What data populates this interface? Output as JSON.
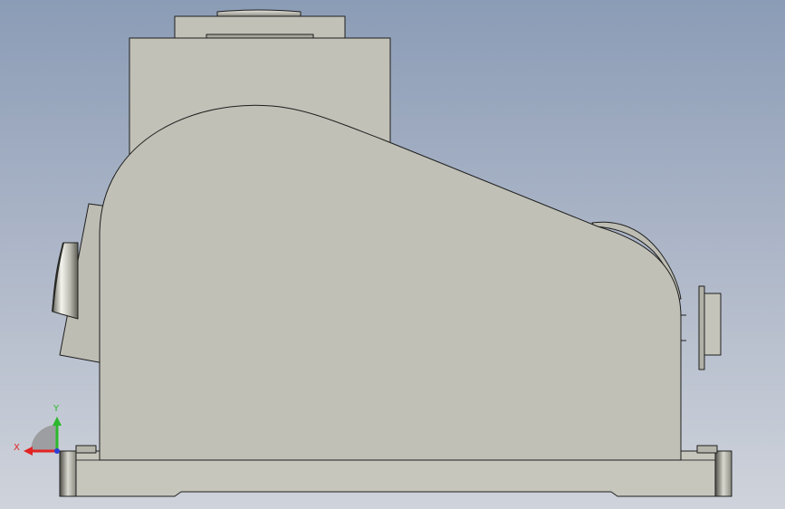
{
  "viewport": {
    "background_top": "#8b9cb6",
    "background_bottom": "#cfd3db"
  },
  "model": {
    "body_color": "#c0c0b6",
    "edge_color": "#1e1e1e"
  },
  "triad": {
    "x_label": "X",
    "y_label": "Y",
    "x_color": "#e32222",
    "y_color": "#2bb82b",
    "z_color": "#2a3fd6"
  }
}
